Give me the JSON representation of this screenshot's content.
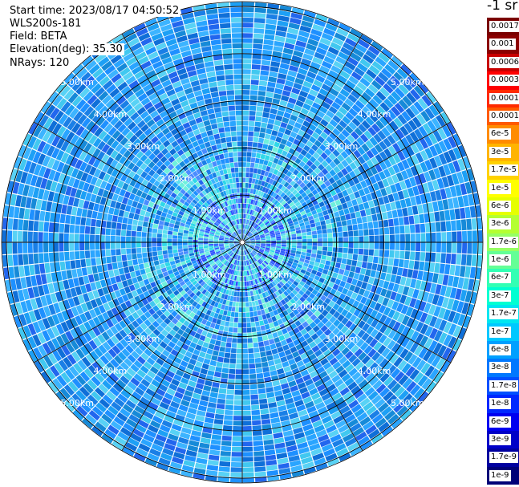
{
  "header": {
    "start_time": "Start time: 2023/08/17 04:50:52",
    "instrument": "WLS200s-181",
    "field": "Field: BETA",
    "elevation": "Elevation(deg): 35.30",
    "nrays": "NRays: 120"
  },
  "colorbar": {
    "units": "-1 sr",
    "labels": [
      "0.0017",
      "0.001",
      "0.0006",
      "0.0003",
      "0.00017",
      "0.0001",
      "6e-5",
      "3e-5",
      "1.7e-5",
      "1e-5",
      "6e-6",
      "3e-6",
      "1.7e-6",
      "1e-6",
      "6e-7",
      "3e-7",
      "1.7e-7",
      "1e-7",
      "6e-8",
      "3e-8",
      "1.7e-8",
      "1e-8",
      "6e-9",
      "3e-9",
      "1.7e-9",
      "1e-9"
    ],
    "colors": [
      "#7a0000",
      "#8c0000",
      "#c80000",
      "#ff0000",
      "#ff2a00",
      "#ff5a00",
      "#ff8c00",
      "#ffb400",
      "#ffd200",
      "#ffff00",
      "#e6ff00",
      "#b4ff32",
      "#96ff64",
      "#64ff96",
      "#32ffb4",
      "#00ffd2",
      "#00e6f0",
      "#00c8ff",
      "#00a0ff",
      "#0078ff",
      "#0050ff",
      "#0028ff",
      "#0000f0",
      "#0000c8",
      "#0000a0",
      "#000078"
    ]
  },
  "chart_data": {
    "type": "ppi",
    "field": "BETA",
    "units": "-1 sr",
    "elevation_deg": 35.3,
    "n_rays": 120,
    "range_rings_km": [
      1,
      2,
      3,
      4,
      5
    ],
    "ring_labels": [
      "1.00km",
      "2.00km",
      "3.00km",
      "4.00km",
      "5.00km"
    ],
    "radial_lines_deg": [
      0,
      30,
      60,
      90,
      120,
      150,
      180,
      210,
      240,
      270,
      300,
      330
    ],
    "max_range_km": 5.0,
    "value_range": [
      1e-09,
      0.0017
    ],
    "log_scale": true
  }
}
